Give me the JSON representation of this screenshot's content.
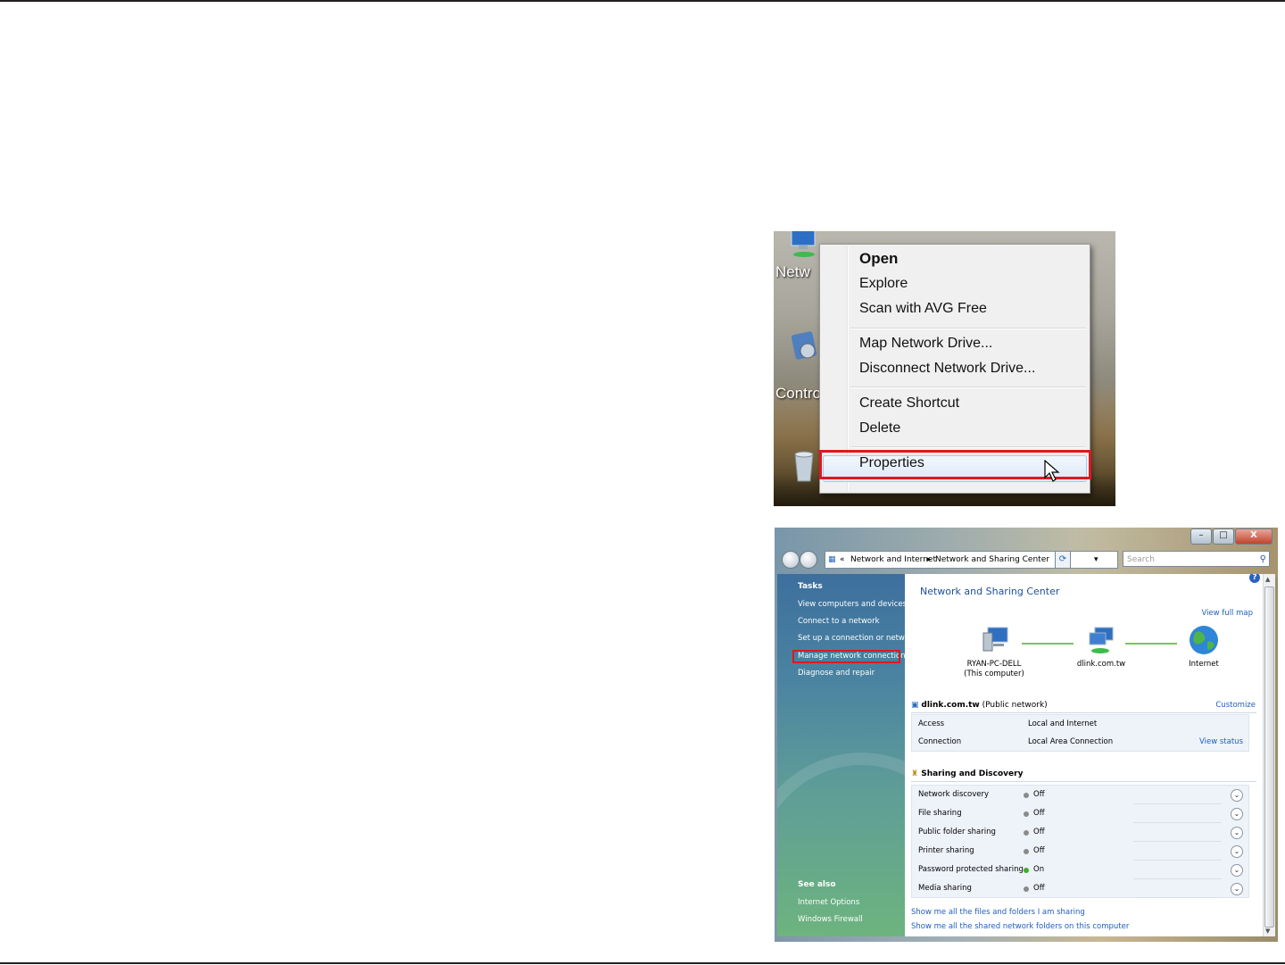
{
  "context_menu_shot": {
    "desktop_labels": [
      "Netw",
      "Contro"
    ],
    "items": [
      {
        "label": "Open",
        "bold": true
      },
      {
        "label": "Explore"
      },
      {
        "label": "Scan with AVG Free"
      },
      {
        "label": "Map Network Drive..."
      },
      {
        "label": "Disconnect Network Drive..."
      },
      {
        "label": "Create Shortcut"
      },
      {
        "label": "Delete"
      },
      {
        "label": "Properties",
        "highlighted": true
      }
    ],
    "highlight_color": "#e0171f"
  },
  "sharing_center_shot": {
    "window_buttons": {
      "minimize": "–",
      "maximize": "□",
      "close": "X"
    },
    "address": {
      "prefix": "«",
      "crumbs": [
        "Network and Internet",
        "Network and Sharing Center"
      ]
    },
    "search_placeholder": "Search",
    "sidebar": {
      "tasks_heading": "Tasks",
      "tasks": [
        "View computers and devices",
        "Connect to a network",
        "Set up a connection or network",
        "Manage network connections",
        "Diagnose and repair"
      ],
      "see_also_heading": "See also",
      "see_also": [
        "Internet Options",
        "Windows Firewall"
      ]
    },
    "main": {
      "title": "Network and Sharing Center",
      "view_full_map": "View full map",
      "nodes": [
        {
          "line1": "RYAN-PC-DELL",
          "line2": "(This computer)"
        },
        {
          "line1": "dlink.com.tw",
          "line2": ""
        },
        {
          "line1": "Internet",
          "line2": ""
        }
      ],
      "network": {
        "name": "dlink.com.tw",
        "type": "(Public network)",
        "customize": "Customize",
        "rows": [
          {
            "label": "Access",
            "value": "Local and Internet",
            "action": ""
          },
          {
            "label": "Connection",
            "value": "Local Area Connection",
            "action": "View status"
          }
        ]
      },
      "sharing": {
        "heading": "Sharing and Discovery",
        "rows": [
          {
            "label": "Network discovery",
            "state": "Off",
            "color": "#8a8a8a"
          },
          {
            "label": "File sharing",
            "state": "Off",
            "color": "#8a8a8a"
          },
          {
            "label": "Public folder sharing",
            "state": "Off",
            "color": "#8a8a8a"
          },
          {
            "label": "Printer sharing",
            "state": "Off",
            "color": "#8a8a8a"
          },
          {
            "label": "Password protected sharing",
            "state": "On",
            "color": "#3fae2a"
          },
          {
            "label": "Media sharing",
            "state": "Off",
            "color": "#8a8a8a"
          }
        ]
      },
      "footer_links": [
        "Show me all the files and folders I am sharing",
        "Show me all the shared network folders on this computer"
      ]
    }
  }
}
